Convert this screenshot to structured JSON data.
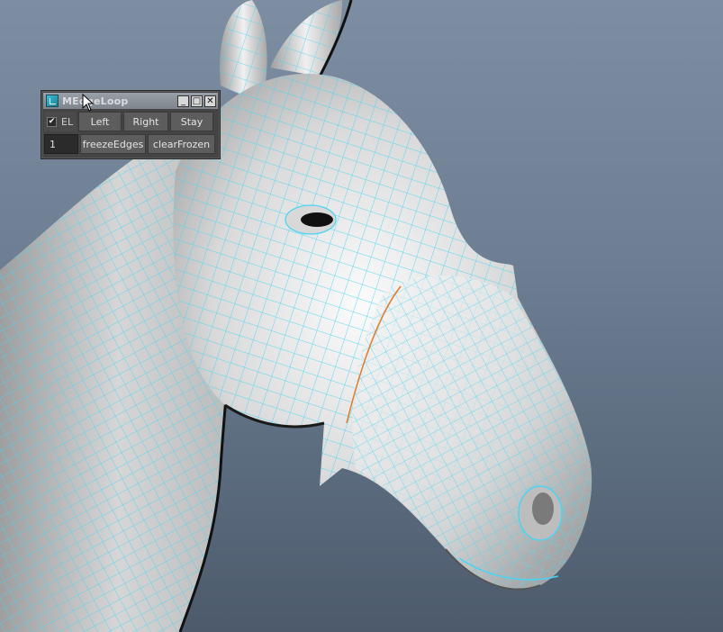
{
  "window": {
    "title": "MEdgeLoop",
    "controls": {
      "minimize": "_",
      "maximize": "□",
      "close": "✕"
    }
  },
  "row1": {
    "checkbox": {
      "checked": true,
      "mark": "✔",
      "label": "EL"
    },
    "buttons": [
      "Left",
      "Right",
      "Stay"
    ]
  },
  "row2": {
    "field_value": "1",
    "buttons": [
      "freezeEdges",
      "clearFrozen"
    ]
  },
  "colors": {
    "wireframe": "#49d4f4",
    "selected_edge": "#e07a2a",
    "mesh_light": "#f3f3f3",
    "mesh_dark": "#8a8a8a",
    "background_top": "#7d8da2",
    "background_bottom": "#4c5a6b"
  },
  "icons": {
    "app": "maya-app-icon",
    "cursor": "mouse-pointer-icon"
  }
}
